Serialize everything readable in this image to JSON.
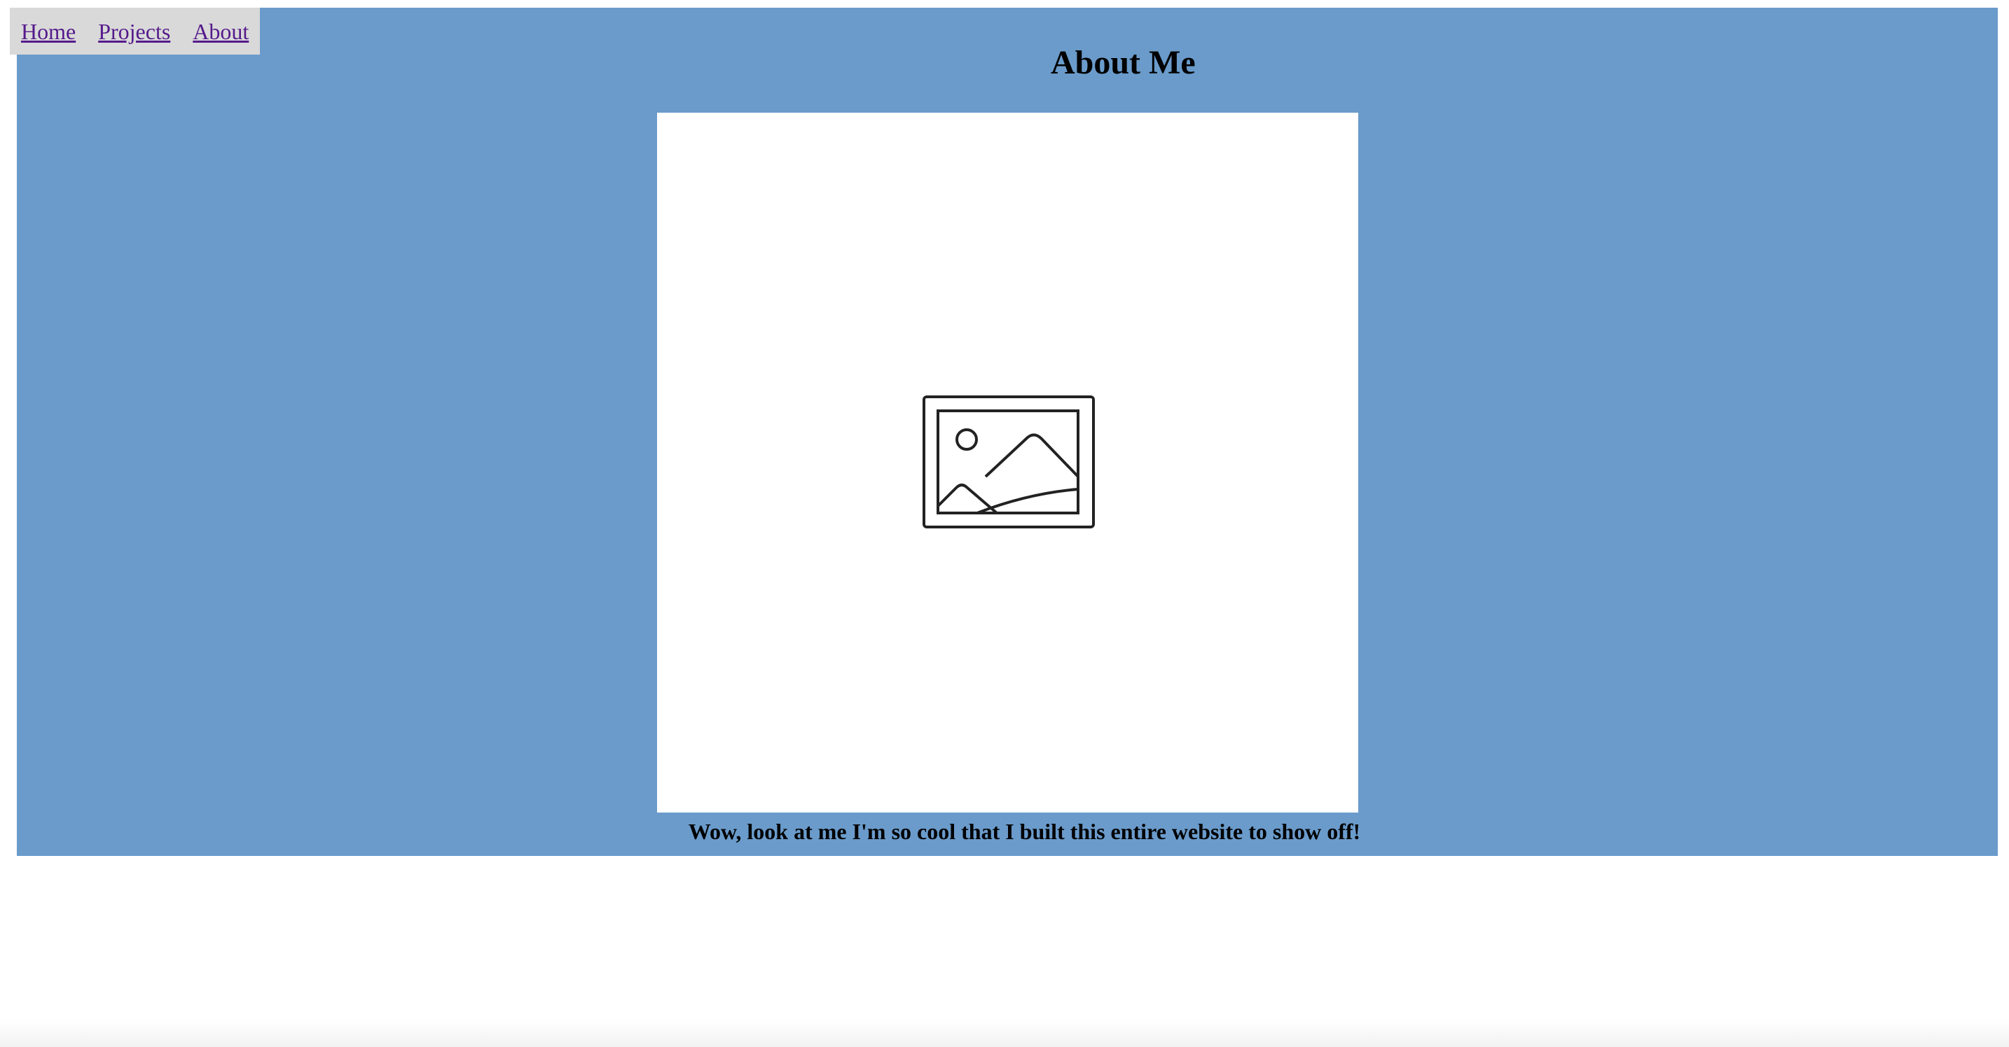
{
  "colors": {
    "hero_background": "#6a9bcb",
    "nav_background": "#d9d9d9",
    "link_color": "#551a8b",
    "text_color": "#000000",
    "photo_background": "#ffffff"
  },
  "nav": {
    "items": [
      {
        "label": "Home"
      },
      {
        "label": "Projects"
      },
      {
        "label": "About"
      }
    ]
  },
  "main": {
    "title": "About Me",
    "photo_icon": "image-placeholder-icon",
    "caption": "Wow, look at me I'm so cool that I built this entire website to show off!"
  }
}
